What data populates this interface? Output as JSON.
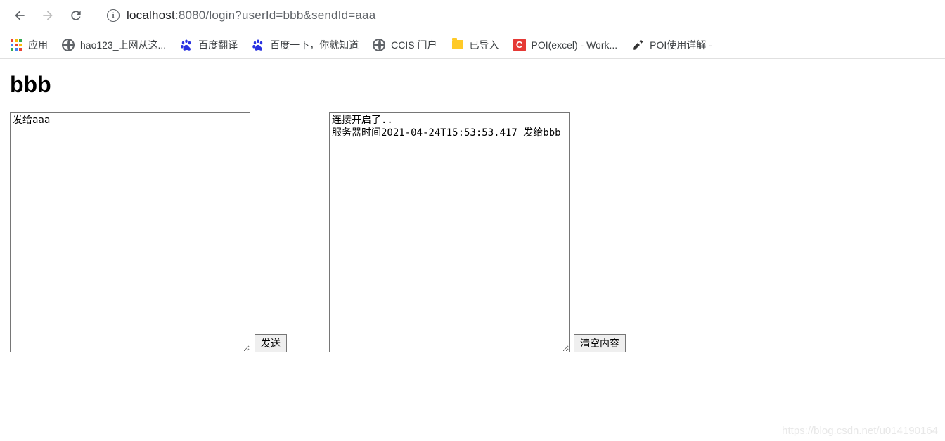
{
  "browser": {
    "url_host": "localhost",
    "url_path": ":8080/login?userId=bbb&sendId=aaa"
  },
  "bookmarks": {
    "apps": "应用",
    "hao123": "hao123_上网从这...",
    "baidu_translate": "百度翻译",
    "baidu": "百度一下，你就知道",
    "ccis": "CCIS 门户",
    "imported": "已导入",
    "poi_excel": "POI(excel) - Work...",
    "poi_detail": "POI使用详解 -"
  },
  "page": {
    "title": "bbb",
    "input_value": "发给aaa",
    "send_button": "发送",
    "log_value": "连接开启了..\n服务器时间2021-04-24T15:53:53.417 发给bbb",
    "clear_button": "清空内容"
  },
  "watermark": "https://blog.csdn.net/u014190164"
}
